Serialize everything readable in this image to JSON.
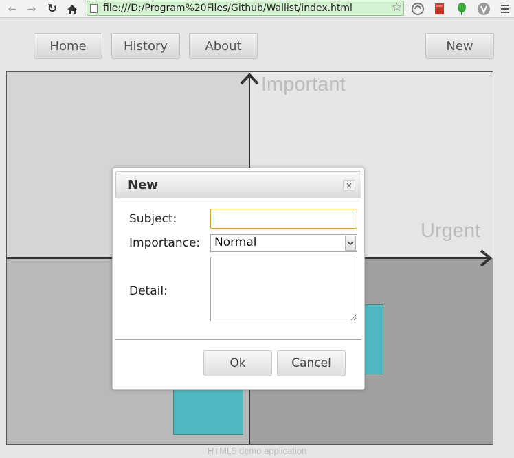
{
  "browser": {
    "url": "file:///D:/Program%20Files/Github/Wallist/index.html"
  },
  "nav": {
    "home": "Home",
    "history": "History",
    "about": "About",
    "new": "New"
  },
  "board": {
    "label_important": "Important",
    "label_urgent": "Urgent"
  },
  "dialog": {
    "title": "New",
    "close_symbol": "×",
    "subject_label": "Subject:",
    "subject_value": "",
    "importance_label": "Importance:",
    "importance_selected": "Normal",
    "detail_label": "Detail:",
    "detail_value": "",
    "ok_label": "Ok",
    "cancel_label": "Cancel"
  },
  "footer": {
    "text": "HTML5 demo application"
  },
  "colors": {
    "note": "#4fb8c2",
    "quadrant_important_not_urgent": "#d5d5d5",
    "quadrant_important_urgent": "#e6e6e6",
    "quadrant_not_important_not_urgent": "#b9b9b9",
    "quadrant_urgent_not_important": "#a0a0a0",
    "address_bar": "#d5f2d2"
  }
}
